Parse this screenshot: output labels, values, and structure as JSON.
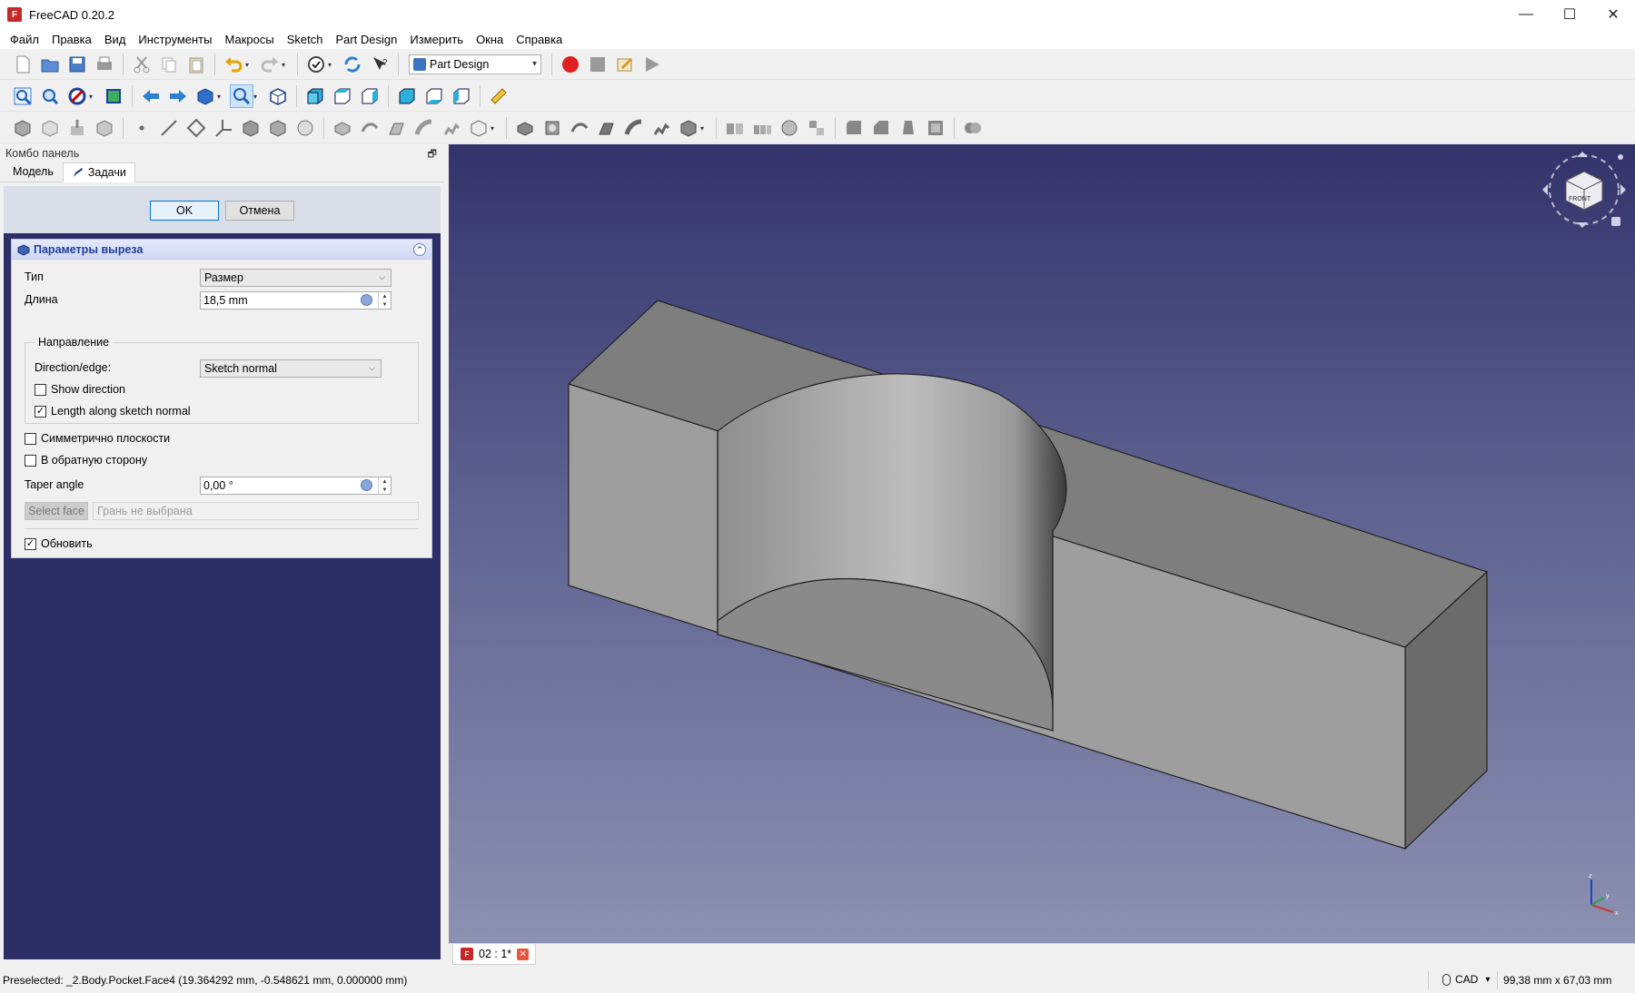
{
  "window": {
    "title": "FreeCAD 0.20.2",
    "logo_text": "F",
    "minimize_label": "—",
    "maximize_label": "☐",
    "close_label": "✕"
  },
  "menu": [
    "Файл",
    "Правка",
    "Вид",
    "Инструменты",
    "Макросы",
    "Sketch",
    "Part Design",
    "Измерить",
    "Окна",
    "Справка"
  ],
  "toolbar": {
    "workbench": "Part Design"
  },
  "combo": {
    "title": "Комбо панель",
    "undock_label": "🗗",
    "tabs": [
      "Модель",
      "Задачи"
    ]
  },
  "task": {
    "ok": "OK",
    "cancel": "Отмена",
    "panel_title": "Параметры выреза",
    "type_label": "Тип",
    "type_value": "Размер",
    "length_label": "Длина",
    "length_value": "18,5 mm",
    "direction_group": "Направление",
    "direction_edge_label": "Direction/edge:",
    "direction_edge_value": "Sketch normal",
    "show_direction": "Show direction",
    "show_direction_checked": false,
    "length_along_normal": "Length along sketch normal",
    "length_along_normal_checked": true,
    "symmetric": "Симметрично плоскости",
    "symmetric_checked": false,
    "reversed": "В обратную сторону",
    "reversed_checked": false,
    "taper_label": "Taper angle",
    "taper_value": "0,00 °",
    "select_face": "Select face",
    "face_placeholder": "Грань не выбрана",
    "update": "Обновить",
    "update_checked": true
  },
  "viewport": {
    "navcube_face": "FRONT",
    "axis_x": "x",
    "axis_y": "y",
    "axis_z": "z"
  },
  "document_tab": {
    "label": "02 : 1*",
    "close": "✕"
  },
  "status": {
    "message": "Preselected: _2.Body.Pocket.Face4 (19.364292 mm, -0.548621 mm, 0.000000 mm)",
    "nav_style": "CAD",
    "nav_caret": "▾",
    "dimensions": "99,38 mm x 67,03 mm"
  },
  "colors": {
    "accent": "#1f3f99",
    "viewport_top": "#33336b",
    "viewport_bottom": "#8c90b1",
    "record": "#e02020"
  }
}
